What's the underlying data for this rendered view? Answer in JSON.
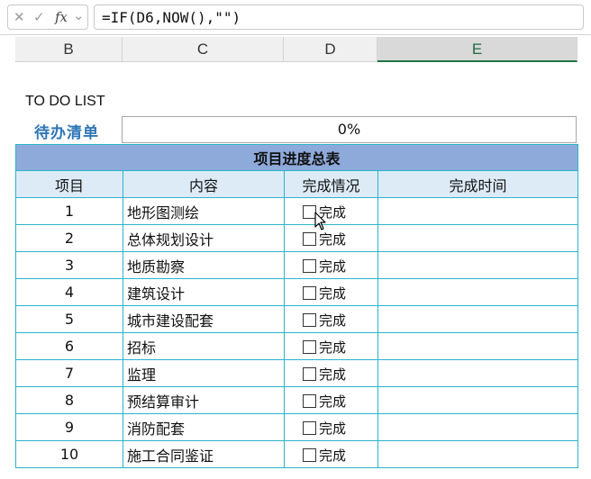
{
  "formula_bar": {
    "cancel_icon": "✕",
    "confirm_icon": "✓",
    "fx_label": "fx",
    "dropdown_icon": "⌄",
    "formula": "=IF(D6,NOW(),\"\")"
  },
  "columns": [
    "B",
    "C",
    "D",
    "E"
  ],
  "selected_column": "E",
  "todo_title": "TO DO LIST",
  "pending_label": "待办清单",
  "progress": "0%",
  "table": {
    "title": "项目进度总表",
    "headers": [
      "项目",
      "内容",
      "完成情况",
      "完成时间"
    ],
    "checkbox_label": "完成",
    "rows": [
      {
        "num": "1",
        "content": "地形图测绘",
        "checked": false,
        "time": ""
      },
      {
        "num": "2",
        "content": "总体规划设计",
        "checked": false,
        "time": ""
      },
      {
        "num": "3",
        "content": "地质勘察",
        "checked": false,
        "time": ""
      },
      {
        "num": "4",
        "content": "建筑设计",
        "checked": false,
        "time": ""
      },
      {
        "num": "5",
        "content": "城市建设配套",
        "checked": false,
        "time": ""
      },
      {
        "num": "6",
        "content": "招标",
        "checked": false,
        "time": ""
      },
      {
        "num": "7",
        "content": "监理",
        "checked": false,
        "time": ""
      },
      {
        "num": "8",
        "content": "预结算审计",
        "checked": false,
        "time": ""
      },
      {
        "num": "9",
        "content": "消防配套",
        "checked": false,
        "time": ""
      },
      {
        "num": "10",
        "content": "施工合同鉴证",
        "checked": false,
        "time": ""
      }
    ]
  },
  "colors": {
    "title_fill": "#8eaadb",
    "header_fill": "#ddebf7",
    "border": "#2bb3c9",
    "pending_label": "#2e75b6"
  }
}
